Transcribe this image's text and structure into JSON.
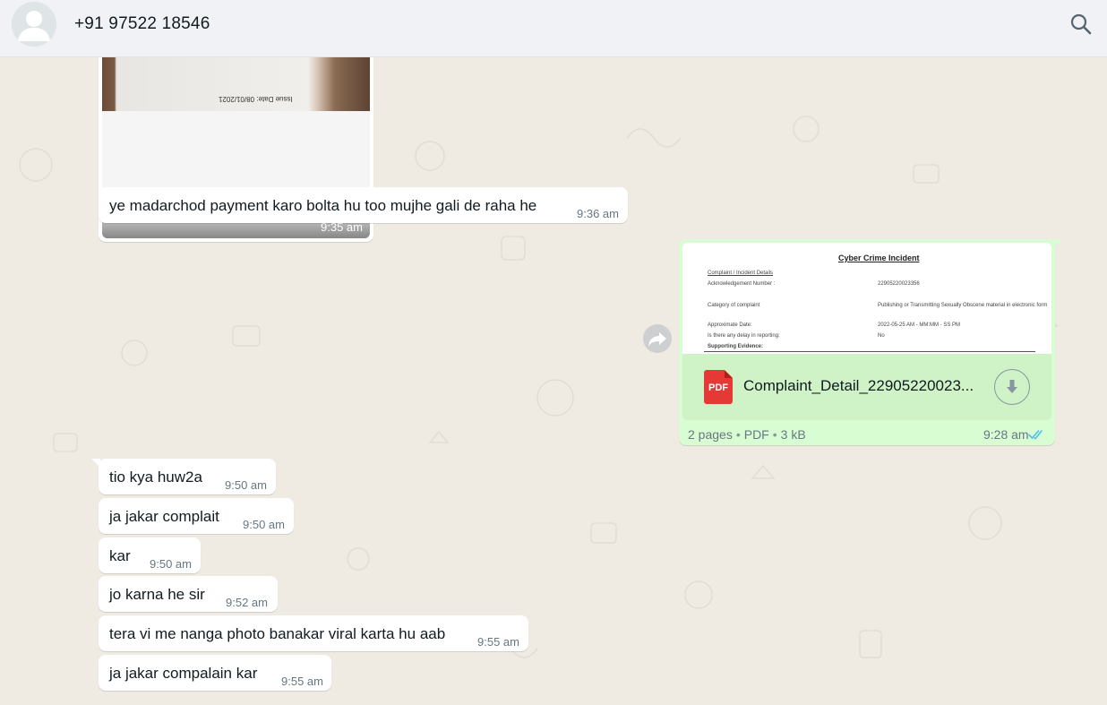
{
  "header": {
    "contact_name": "+91 97522 18546",
    "avatar_icon": "default-avatar-icon",
    "search_icon": "search-icon"
  },
  "image_message": {
    "caption_text": "Issue Date: 08/01/2021",
    "time": "9:35 am"
  },
  "incoming_top": [
    {
      "text": "ye madarchod payment karo bolta hu too mujhe gali de raha he",
      "time": "9:36 am"
    }
  ],
  "outgoing_document": {
    "preview": {
      "title": "Cyber Crime Incident",
      "rows": [
        "Complaint / Incident Details",
        "Acknowledgement Number :",
        "22905220023356",
        "Category of complaint",
        "Publishing or Transmitting Sexually Obscene material in electronic form",
        "Approximate Date:",
        "2022-05-25  AM - MM:MM - SS PM",
        "Is there any delay in reporting:",
        "No",
        "Supporting Evidence:"
      ]
    },
    "file_name": "Complaint_Detail_22905220023...",
    "file_type_label": "PDF",
    "pages": "2 pages",
    "type": "PDF",
    "size": "3 kB",
    "time": "9:28 am",
    "status_icon": "double-check-read-icon",
    "download_icon": "download-icon",
    "forward_icon": "forward-icon",
    "tick_color": "#53bdeb"
  },
  "incoming_bottom": [
    {
      "text": "tio kya huw2a",
      "time": "9:50 am"
    },
    {
      "text": "ja jakar complait",
      "time": "9:50 am"
    },
    {
      "text": "kar",
      "time": "9:50 am"
    },
    {
      "text": "jo karna he sir",
      "time": "9:52 am"
    },
    {
      "text": "tera vi me nanga photo banakar viral karta hu aab",
      "time": "9:55 am"
    },
    {
      "text": "ja jakar compalain kar",
      "time": "9:55 am"
    }
  ],
  "colors": {
    "chat_background": "#efeae2",
    "incoming_bubble": "#ffffff",
    "outgoing_bubble": "#d9fdd3",
    "header_background": "#f0f2f5"
  }
}
